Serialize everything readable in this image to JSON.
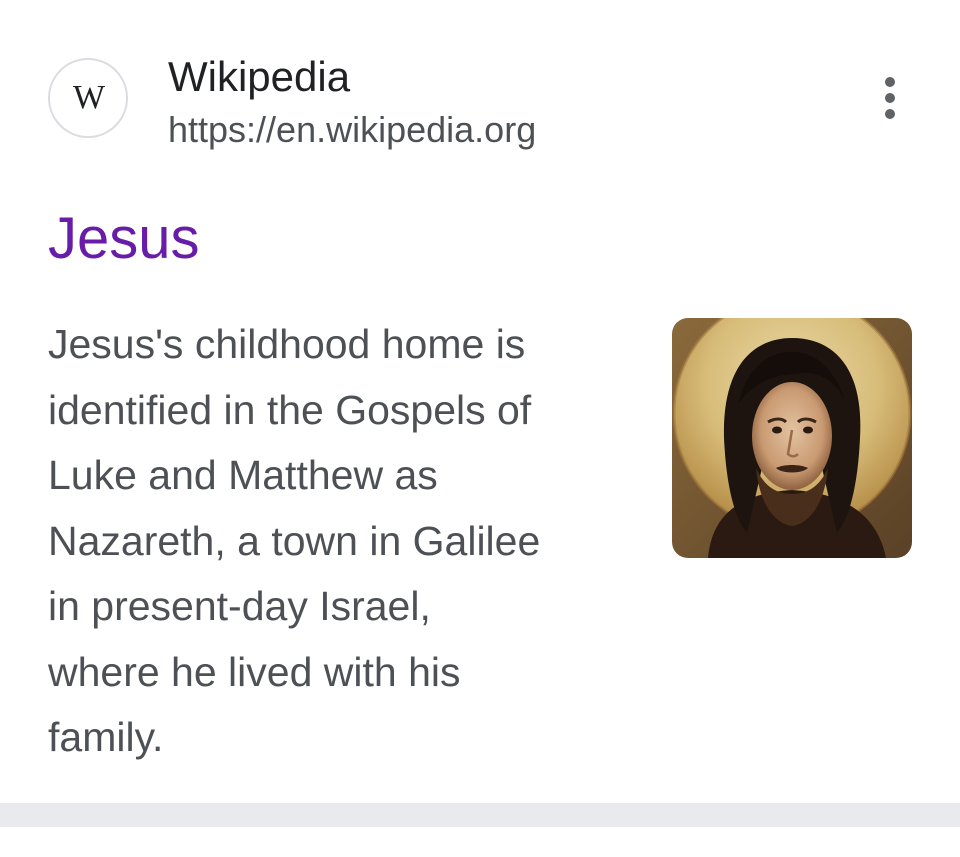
{
  "source": {
    "favicon_icon": "wikipedia-w-icon",
    "favicon_letter": "W",
    "site_name": "Wikipedia",
    "url": "https://en.wikipedia.org",
    "more_icon": "more-vertical-icon"
  },
  "result": {
    "title": "Jesus",
    "snippet_lines": [
      "Jesus's childhood home is",
      "identified in the Gospels of",
      "Luke and Matthew as",
      "Nazareth, a town in Galilee",
      "in present-day Israel,",
      "where he lived with his",
      "family."
    ],
    "thumbnail_icon": "icon-portrait-thumbnail"
  },
  "colors": {
    "title_visited": "#681da8",
    "text_primary": "#202124",
    "text_secondary": "#4d5156",
    "divider": "#e8eaed"
  }
}
